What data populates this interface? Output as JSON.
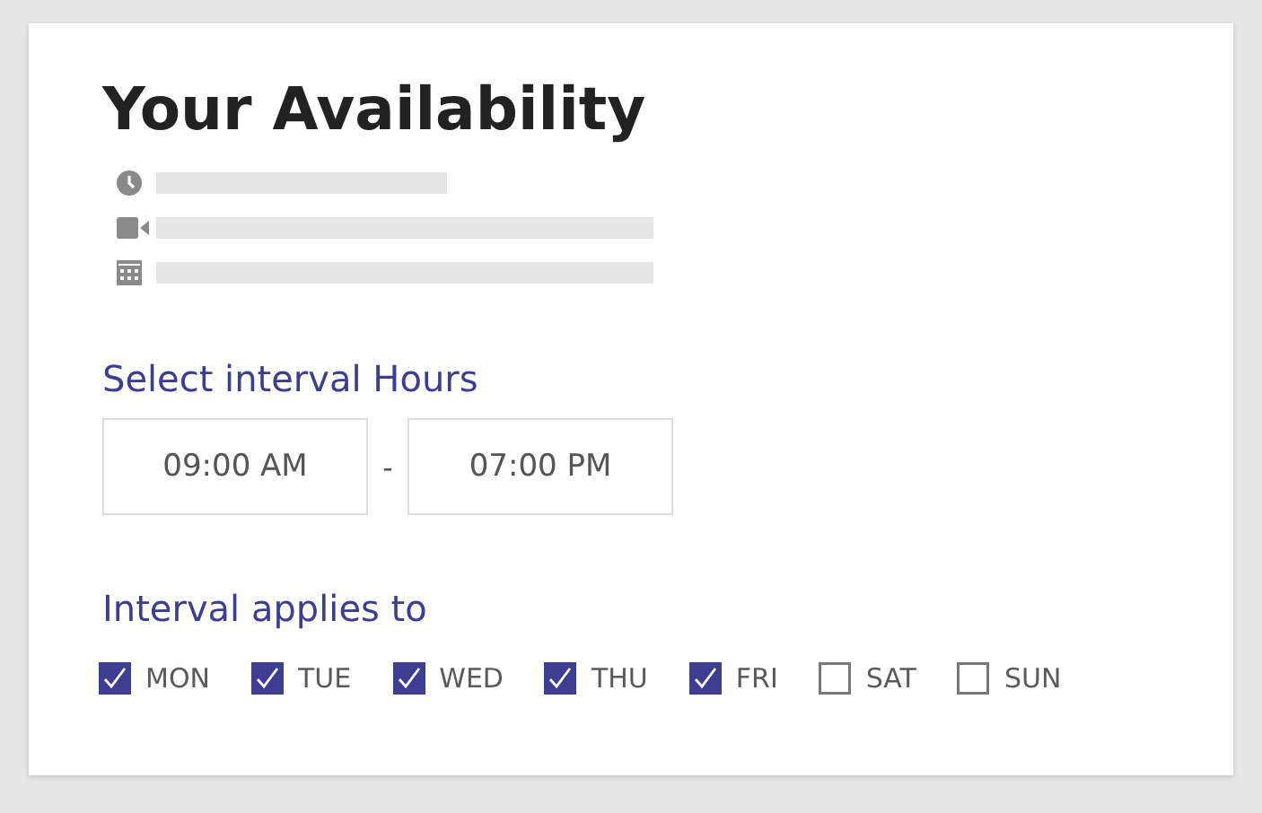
{
  "title": "Your Availability",
  "details": [
    {
      "kind": "clock"
    },
    {
      "kind": "video"
    },
    {
      "kind": "calendar"
    }
  ],
  "interval": {
    "heading": "Select interval Hours",
    "start": "09:00 AM",
    "separator": "-",
    "end": "07:00 PM"
  },
  "days_heading": "Interval applies to",
  "days": [
    {
      "label": "MON",
      "checked": true
    },
    {
      "label": "TUE",
      "checked": true
    },
    {
      "label": "WED",
      "checked": true
    },
    {
      "label": "THU",
      "checked": true
    },
    {
      "label": "FRI",
      "checked": true
    },
    {
      "label": "SAT",
      "checked": false
    },
    {
      "label": "SUN",
      "checked": false
    }
  ]
}
